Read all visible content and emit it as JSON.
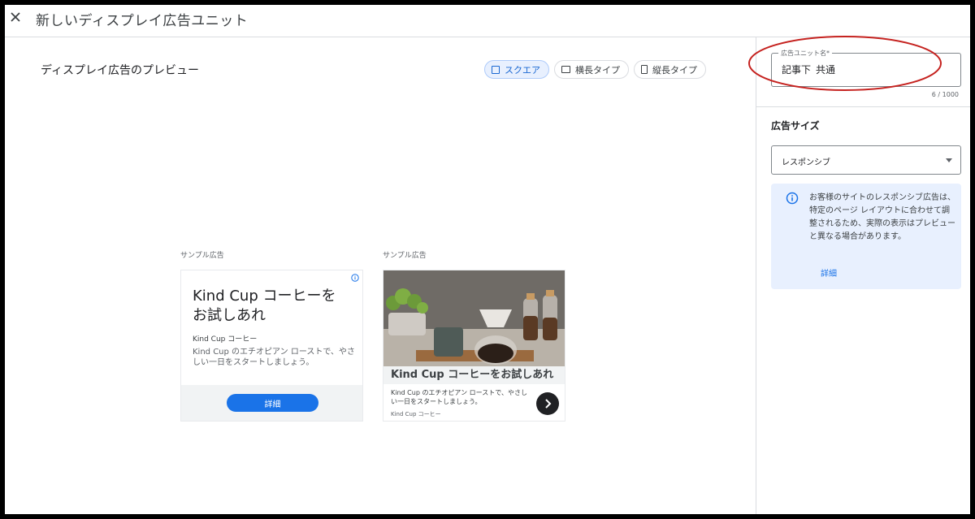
{
  "header": {
    "title": "新しいディスプレイ広告ユニット"
  },
  "preview": {
    "title": "ディスプレイ広告のプレビュー",
    "chips": [
      {
        "label": "スクエア",
        "active": true
      },
      {
        "label": "横長タイプ",
        "active": false
      },
      {
        "label": "縦長タイプ",
        "active": false
      }
    ]
  },
  "samples": {
    "label": "サンプル広告",
    "ad1": {
      "headline": "Kind Cup コーヒーを お試しあれ",
      "brand": "Kind Cup コーヒー",
      "description": "Kind Cup のエチオピアン ローストで、やさしい一日をスタートしましょう。",
      "button": "詳細"
    },
    "ad2": {
      "headline": "Kind Cup コーヒーをお試しあれ",
      "description": "Kind Cup のエチオピアン ローストで、やさしい一日をスタートしましょう。",
      "brand": "Kind Cup コーヒー"
    }
  },
  "panel": {
    "name_field": {
      "label": "広告ユニット名*",
      "value": "記事下_共通",
      "counter": "6 / 1000"
    },
    "size_title": "広告サイズ",
    "size_select": {
      "value": "レスポンシブ"
    },
    "notice": {
      "text": "お客様のサイトのレスポンシブ広告は、特定のページ レイアウトに合わせて調整されるため、実際の表示はプレビューと異なる場合があります。",
      "link": "詳細"
    }
  },
  "colors": {
    "accent": "#1a73e8",
    "annotation": "#c5221f",
    "notice_bg": "#e8f0fe"
  }
}
